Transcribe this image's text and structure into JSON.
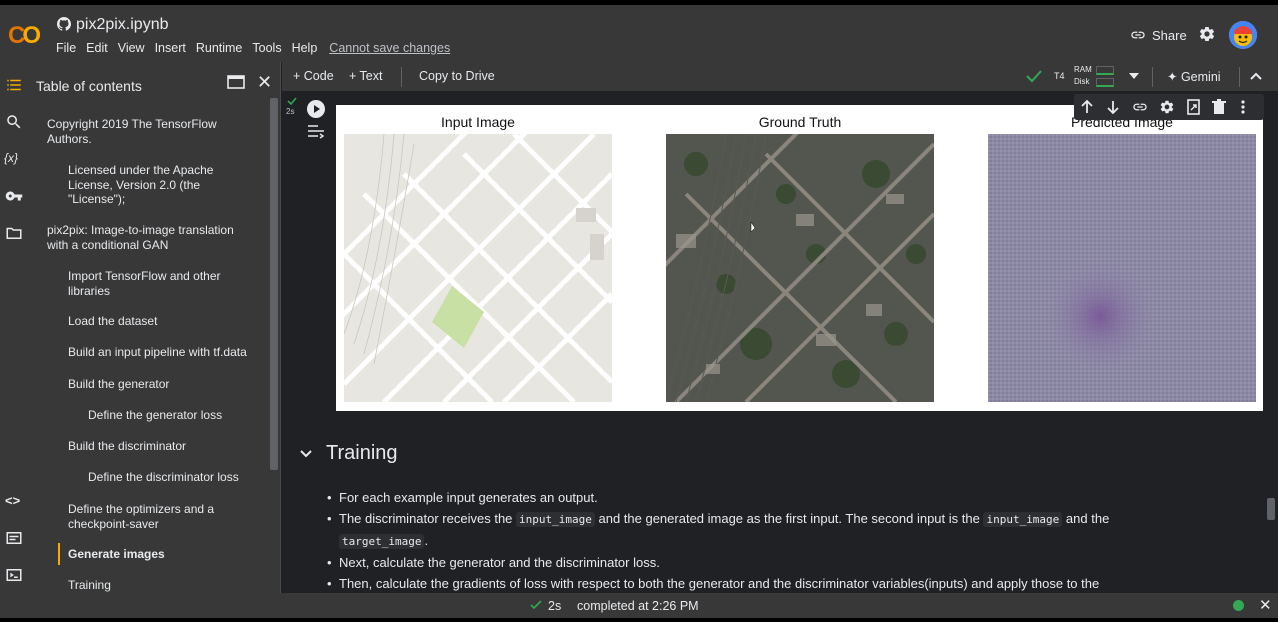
{
  "app": {
    "logo": "CO",
    "notebook_title": "pix2pix.ipynb",
    "menu": [
      "File",
      "Edit",
      "View",
      "Insert",
      "Runtime",
      "Tools",
      "Help"
    ],
    "cannot_save": "Cannot save changes",
    "share_label": "Share"
  },
  "toc": {
    "title": "Table of contents",
    "items": [
      "Copyright 2019 The TensorFlow Authors.",
      "Licensed under the Apache License, Version 2.0 (the \"License\");",
      "pix2pix: Image-to-image translation with a conditional GAN",
      "Import TensorFlow and other libraries",
      "Load the dataset",
      "Build an input pipeline with tf.data",
      "Build the generator",
      "Define the generator loss",
      "Build the discriminator",
      "Define the discriminator loss",
      "Define the optimizers and a checkpoint-saver",
      "Generate images",
      "Training"
    ],
    "active_index": 11
  },
  "toolbar": {
    "code_label": "Code",
    "text_label": "Text",
    "copy_to_drive": "Copy to Drive",
    "runtime_type": "T4",
    "ram_label": "RAM",
    "disk_label": "Disk",
    "gemini_label": "Gemini"
  },
  "cell": {
    "exec_time": "2s",
    "titles": [
      "Input Image",
      "Ground Truth",
      "Predicted Image"
    ]
  },
  "section": {
    "title": "Training",
    "b1": "For each example input generates an output.",
    "b2_pre": "The discriminator receives the ",
    "b2_code1": "input_image",
    "b2_mid": " and the generated image as the first input. The second input is the ",
    "b2_code2": "input_image",
    "b2_post": " and the",
    "b2_code3": "target_image",
    "b2_end": ".",
    "b3": "Next, calculate the generator and the discriminator loss.",
    "b4": "Then, calculate the gradients of loss with respect to both the generator and the discriminator variables(inputs) and apply those to the"
  },
  "status": {
    "time": "2s",
    "completed": "completed at 2:26 PM"
  },
  "colors": {
    "accent": "#f9ab00",
    "ok_green": "#34a853"
  }
}
